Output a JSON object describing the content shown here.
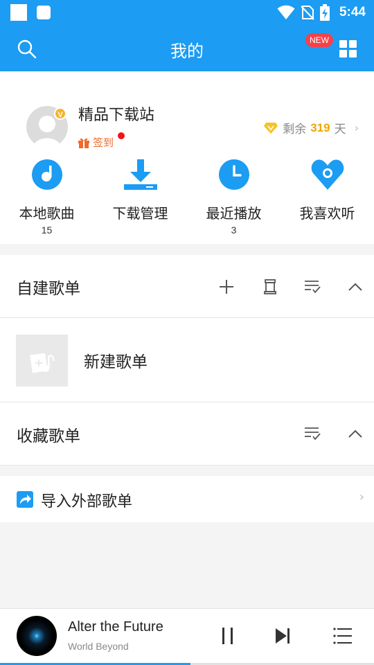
{
  "status_bar": {
    "time": "5:44",
    "icons": [
      "wifi-icon",
      "no-sim-icon",
      "battery-charging-icon"
    ]
  },
  "header": {
    "title": "我的",
    "new_badge": "NEW",
    "icons": [
      "search-icon",
      "grid-icon"
    ]
  },
  "profile": {
    "username": "精品下载站",
    "vip_mark": "V",
    "signin_label": "签到",
    "remain_prefix": "剩余",
    "remain_days": "319",
    "remain_suffix": "天"
  },
  "shortcuts": [
    {
      "label": "本地歌曲",
      "count": "15",
      "icon": "music-note-icon"
    },
    {
      "label": "下载管理",
      "count": "",
      "icon": "download-icon"
    },
    {
      "label": "最近播放",
      "count": "3",
      "icon": "clock-icon"
    },
    {
      "label": "我喜欢听",
      "count": "",
      "icon": "heart-icon"
    }
  ],
  "created_playlists": {
    "title": "自建歌单",
    "new_playlist_label": "新建歌单",
    "icons": [
      "add-icon",
      "import-box-icon",
      "sort-list-icon",
      "collapse-icon"
    ]
  },
  "favorited_playlists": {
    "title": "收藏歌单",
    "icons": [
      "sort-list-icon",
      "collapse-icon"
    ]
  },
  "import_external": {
    "label": "导入外部歌单",
    "icon": "share-arrow-icon"
  },
  "player": {
    "song_title": "Alter the Future",
    "artist": "World Beyond",
    "progress": 0.51,
    "icons": [
      "pause-icon",
      "next-icon",
      "playlist-icon"
    ]
  },
  "colors": {
    "accent": "#1c9cf2",
    "badge_red": "#f5414b",
    "gold": "#f0a500",
    "signin_orange": "#f06a2b"
  }
}
